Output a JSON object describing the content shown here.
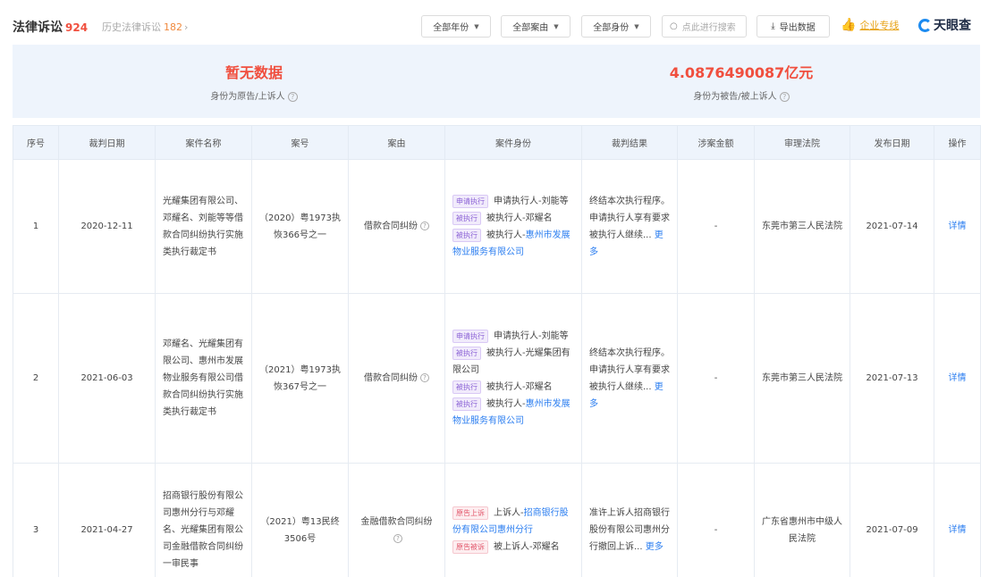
{
  "header": {
    "title": "法律诉讼",
    "title_count": "924",
    "related_label": "历史法律诉讼",
    "related_count": "182",
    "related_chevron": "›",
    "filters": [
      {
        "label": "全部年份"
      },
      {
        "label": "全部案由"
      },
      {
        "label": "全部身份"
      }
    ],
    "search_placeholder": "点此进行搜索",
    "export_label": "导出数据",
    "vip_label": "企业专线",
    "logo_text": "天眼查"
  },
  "summary": {
    "left_value": "暂无数据",
    "left_label": "身份为原告/上诉人",
    "right_value": "4.0876490087亿元",
    "right_label": "身份为被告/被上诉人"
  },
  "table": {
    "headers": [
      "序号",
      "裁判日期",
      "案件名称",
      "案号",
      "案由",
      "案件身份",
      "裁判结果",
      "涉案金额",
      "审理法院",
      "发布日期",
      "操作"
    ],
    "rows": [
      {
        "index": "1",
        "date": "2020-12-11",
        "case_name": "光耀集团有限公司、邓耀名、刘能等等借款合同纠纷执行实施类执行裁定书",
        "case_no": "（2020）粤1973执恢366号之一",
        "cause": "借款合同纠纷",
        "parties": [
          {
            "tag": "申请执行",
            "tag_style": "purple",
            "text": "申请执行人",
            "name": "刘能等"
          },
          {
            "tag": "被执行",
            "tag_style": "purple",
            "text": "被执行人",
            "name": "邓耀名"
          },
          {
            "tag": "被执行",
            "tag_style": "purple",
            "text": "被执行人",
            "name": "惠州市发展物业服务有限公司"
          }
        ],
        "result": "终结本次执行程序。申请执行人享有要求被执行人继续...",
        "more_label": "更多",
        "amount": "-",
        "court": "东莞市第三人民法院",
        "publish_date": "2021-07-14",
        "action": "详情"
      },
      {
        "index": "2",
        "date": "2021-06-03",
        "case_name": "邓耀名、光耀集团有限公司、惠州市发展物业服务有限公司借款合同纠纷执行实施类执行裁定书",
        "case_no": "（2021）粤1973执恢367号之一",
        "cause": "借款合同纠纷",
        "parties": [
          {
            "tag": "申请执行",
            "tag_style": "purple",
            "text": "申请执行人",
            "name": "刘能等"
          },
          {
            "tag": "被执行",
            "tag_style": "purple",
            "text": "被执行人",
            "name": "光耀集团有限公司"
          },
          {
            "tag": "被执行",
            "tag_style": "purple",
            "text": "被执行人",
            "name": "邓耀名"
          },
          {
            "tag": "被执行",
            "tag_style": "purple",
            "text": "被执行人",
            "name": "惠州市发展物业服务有限公司"
          }
        ],
        "result": "终结本次执行程序。申请执行人享有要求被执行人继续...",
        "more_label": "更多",
        "amount": "-",
        "court": "东莞市第三人民法院",
        "publish_date": "2021-07-13",
        "action": "详情"
      },
      {
        "index": "3",
        "date": "2021-04-27",
        "case_name": "招商银行股份有限公司惠州分行与邓耀名、光耀集团有限公司金融借款合同纠纷一审民事",
        "case_no": "（2021）粤13民终3506号",
        "cause": "金融借款合同纠纷",
        "parties": [
          {
            "tag": "原告上诉",
            "tag_style": "red",
            "text": "上诉人",
            "name": "招商银行股份有限公司惠州分行"
          },
          {
            "tag": "原告被诉",
            "tag_style": "red",
            "text": "被上诉人",
            "name": "邓耀名"
          }
        ],
        "result": "准许上诉人招商银行股份有限公司惠州分行撤回上诉...",
        "more_label": "更多",
        "amount": "-",
        "court": "广东省惠州市中级人民法院",
        "publish_date": "2021-07-09",
        "action": "详情"
      }
    ]
  }
}
